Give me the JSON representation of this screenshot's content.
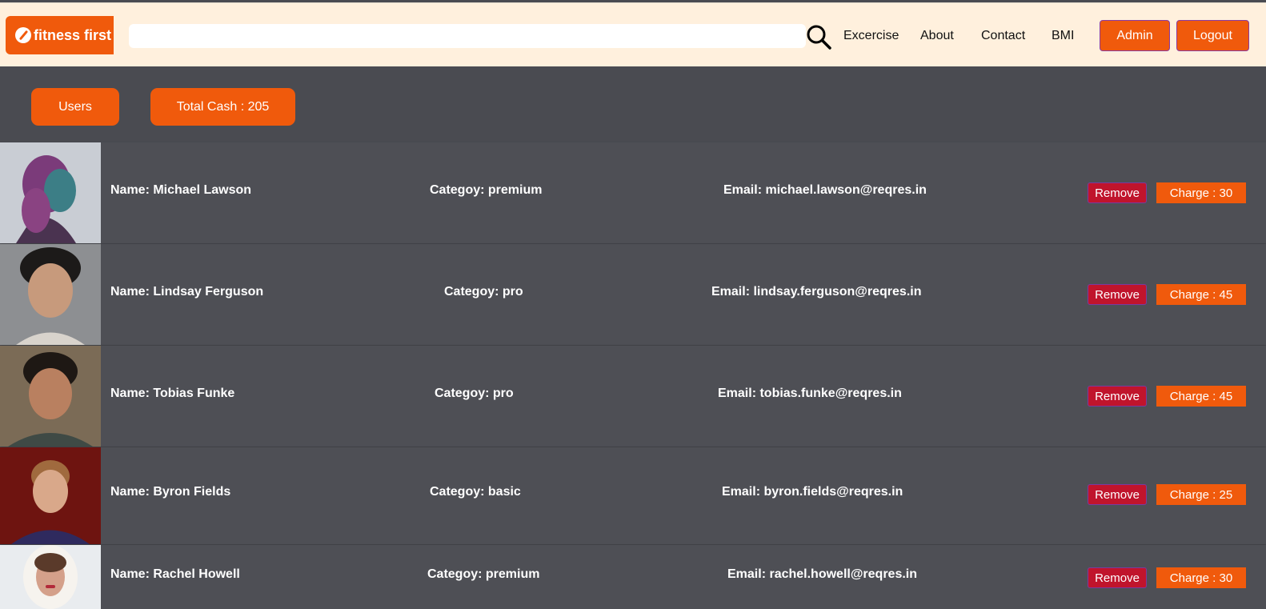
{
  "brand": {
    "name": "fitness first"
  },
  "search": {
    "value": "",
    "placeholder": ""
  },
  "nav": {
    "links": [
      "Excercise",
      "About",
      "Contact",
      "BMI"
    ],
    "admin_label": "Admin",
    "logout_label": "Logout"
  },
  "summary": {
    "users_label": "Users",
    "total_cash_label": "Total Cash : 205"
  },
  "users": [
    {
      "name": "Name: Michael Lawson",
      "category": "Categoy: premium",
      "email": "Email: michael.lawson@reqres.in",
      "remove": "Remove",
      "charge": "Charge : 30"
    },
    {
      "name": "Name: Lindsay Ferguson",
      "category": "Categoy: pro",
      "email": "Email: lindsay.ferguson@reqres.in",
      "remove": "Remove",
      "charge": "Charge : 45"
    },
    {
      "name": "Name: Tobias Funke",
      "category": "Categoy: pro",
      "email": "Email: tobias.funke@reqres.in",
      "remove": "Remove",
      "charge": "Charge : 45"
    },
    {
      "name": "Name: Byron Fields",
      "category": "Categoy: basic",
      "email": "Email: byron.fields@reqres.in",
      "remove": "Remove",
      "charge": "Charge : 25"
    },
    {
      "name": "Name: Rachel Howell",
      "category": "Categoy: premium",
      "email": "Email: rachel.howell@reqres.in",
      "remove": "Remove",
      "charge": "Charge : 30"
    }
  ],
  "colors": {
    "accent": "#f05a0c",
    "navbar_bg": "#fff0dd",
    "page_bg": "#4a4b51",
    "remove": "#c0142c"
  }
}
